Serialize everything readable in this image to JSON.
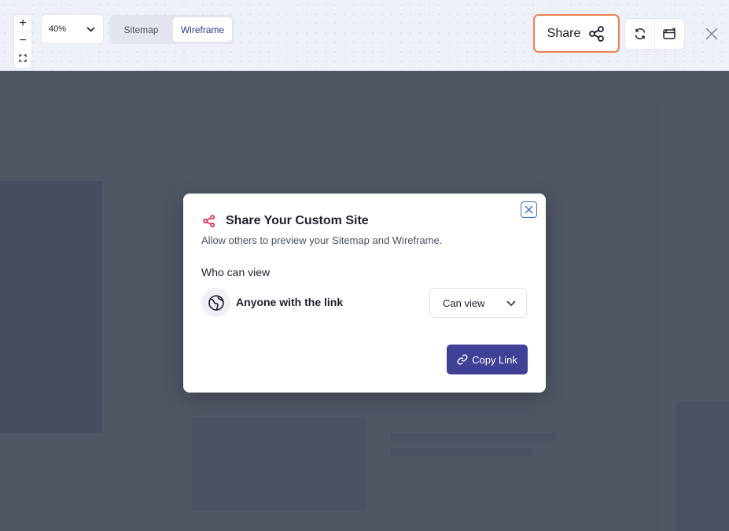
{
  "toolbar": {
    "zoom_in": "+",
    "zoom_out": "−",
    "zoom_value": "40%",
    "view_tabs": [
      {
        "label": "Sitemap",
        "active": false
      },
      {
        "label": "Wireframe",
        "active": true
      }
    ],
    "share_label": "Share",
    "icons": [
      "plus-icon",
      "minus-icon",
      "fit-screen-icon",
      "chevron-down-icon",
      "share-icon",
      "refresh-icon",
      "export-icon",
      "close-icon"
    ]
  },
  "modal": {
    "title": "Share Your Custom Site",
    "subtitle": "Allow others to preview your Sitemap and Wireframe.",
    "who_label": "Who can view",
    "audience": "Anyone with the link",
    "permission": "Can view",
    "copy_label": "Copy Link",
    "icons": [
      "share-icon",
      "globe-icon",
      "chevron-down-icon",
      "link-icon",
      "close-icon"
    ]
  },
  "colors": {
    "accent": "#3f4196",
    "share_border": "#f08051",
    "share_icon": "#e0244f",
    "overlay": "#3e4454",
    "close_focus": "#3a6fd8"
  }
}
